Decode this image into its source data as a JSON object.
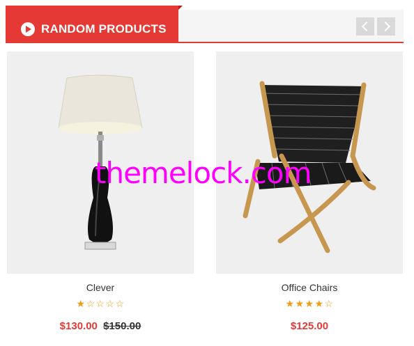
{
  "header": {
    "title": "RANDOM PRODUCTS",
    "prev_icon": "chevron-left-icon",
    "next_icon": "chevron-right-icon",
    "accent": "#e53935"
  },
  "products": [
    {
      "name": "Clever",
      "rating": 1,
      "rating_max": 5,
      "price": "$130.00",
      "old_price": "$150.00",
      "image": "table-lamp"
    },
    {
      "name": "Office Chairs",
      "rating": 4,
      "rating_max": 5,
      "price": "$125.00",
      "old_price": "",
      "image": "woven-lounge-chair"
    }
  ],
  "watermark": "themelock.com"
}
